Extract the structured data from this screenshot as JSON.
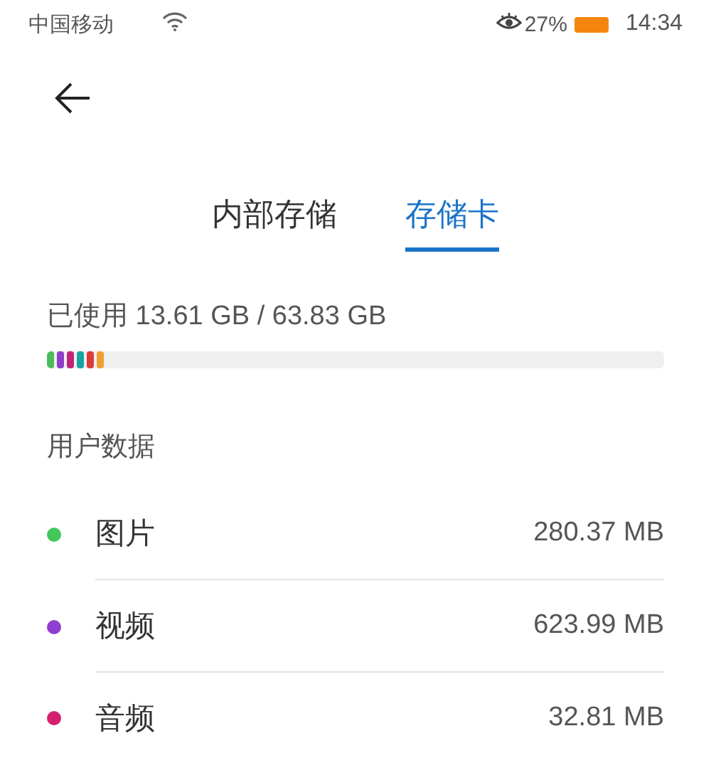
{
  "status_bar": {
    "carrier": "中国移动",
    "battery_percent": "27%",
    "time": "14:34"
  },
  "tabs": [
    {
      "label": "内部存储",
      "selected": false
    },
    {
      "label": "存储卡",
      "selected": true
    }
  ],
  "usage": {
    "text": "已使用 13.61 GB / 63.83 GB",
    "segments": [
      {
        "color": "#4cbb5a"
      },
      {
        "color": "#8e3fc6"
      },
      {
        "color": "#c2237a"
      },
      {
        "color": "#1aa3a3"
      },
      {
        "color": "#e03a3a"
      },
      {
        "color": "#f0a030"
      }
    ]
  },
  "section_title": "用户数据",
  "items": [
    {
      "name": "图片",
      "size": "280.37 MB",
      "color": "#43c75a"
    },
    {
      "name": "视频",
      "size": "623.99 MB",
      "color": "#8e3fd0"
    },
    {
      "name": "音频",
      "size": "32.81 MB",
      "color": "#d4206e"
    }
  ]
}
